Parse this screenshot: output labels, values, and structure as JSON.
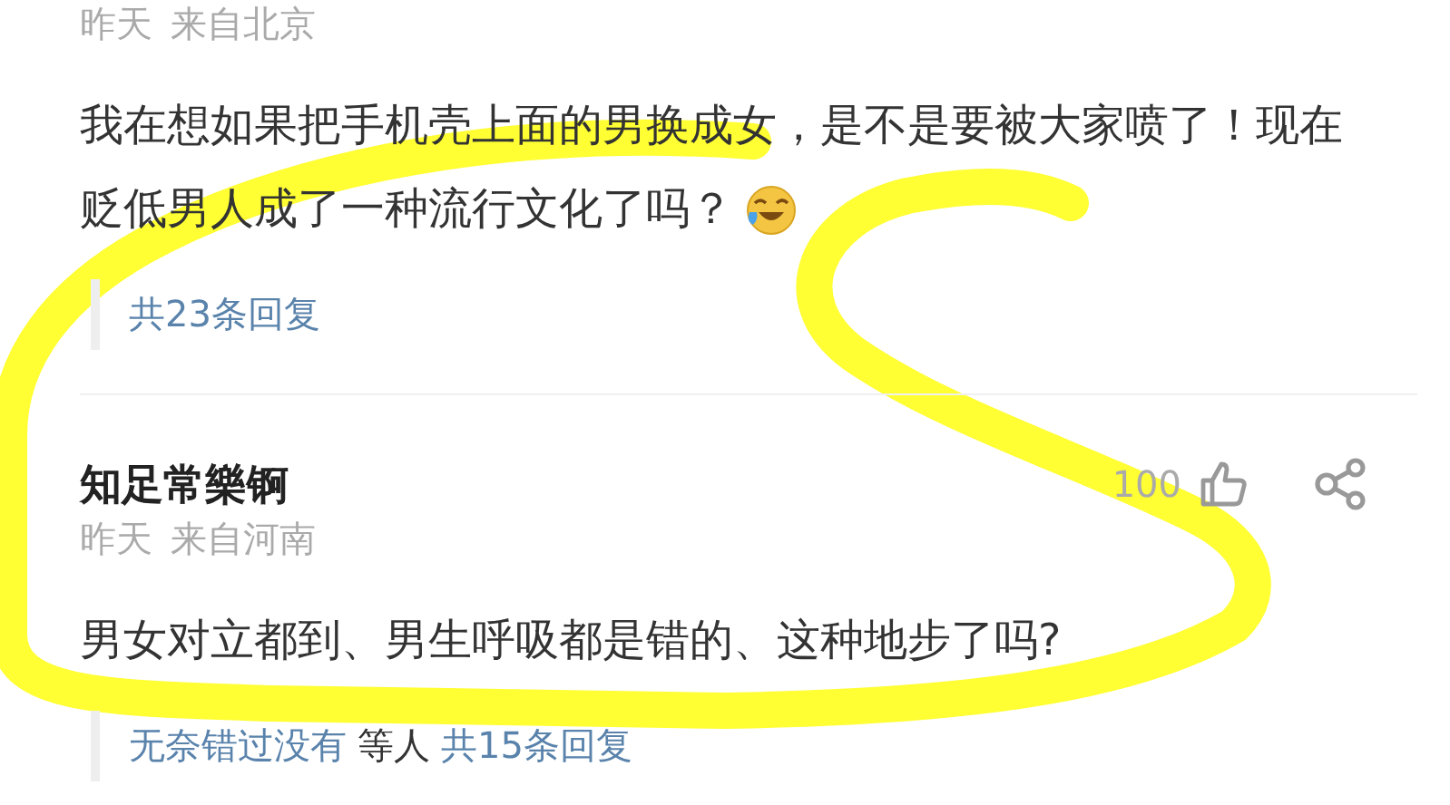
{
  "comments": [
    {
      "time": "昨天",
      "location": "来自北京",
      "text": "我在想如果把手机壳上面的男换成女，是不是要被大家喷了！现在贬低男人成了一种流行文化了吗？",
      "emoji": true,
      "reply_count": "共23条回复"
    },
    {
      "author": "知足常樂锕",
      "time": "昨天",
      "location": "来自河南",
      "text": "男女对立都到、男生呼吸都是错的、这种地步了吗?",
      "emoji": false,
      "reply_users": "无奈错过没有",
      "reply_users_suffix": "等人",
      "reply_count": "共15条回复",
      "likes": "100"
    }
  ],
  "annotation": {
    "kind": "freehand",
    "color": "#ffff33"
  }
}
